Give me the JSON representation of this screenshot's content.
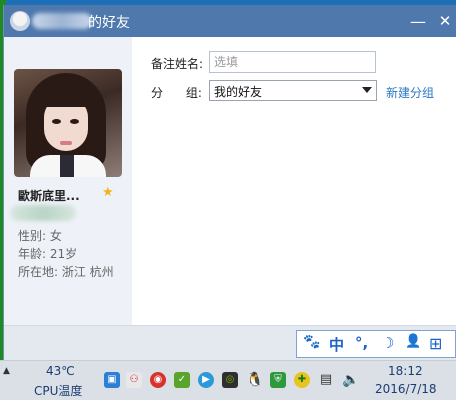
{
  "window": {
    "title": "的好友",
    "minimize_glyph": "—",
    "close_glyph": "✕"
  },
  "profile": {
    "name": "歐斯底里...",
    "gender": "性别: 女",
    "age": "年龄: 21岁",
    "location": "所在地: 浙江  杭州",
    "star_icon": "star-icon"
  },
  "form": {
    "remark_label": "备注姓名:",
    "remark_placeholder": "选填",
    "remark_value": "",
    "group_label": "分      组:",
    "group_value": "我的好友",
    "new_group_link": "新建分组"
  },
  "ime_bar": {
    "items": [
      "🐾",
      "中",
      "°,",
      "☽",
      "👤",
      "⊞"
    ]
  },
  "taskbar": {
    "temperature": "43℃",
    "cpu_label": "CPU温度",
    "time": "18:12",
    "date": "2016/7/18",
    "tray_colors": [
      "#2c7fd6",
      "#e0542c",
      "#d8322c",
      "#58a42c",
      "#2c9ad6",
      "#2f2f2f",
      "#1a1a1a",
      "#2c9a3c",
      "#3a9a2c",
      "#333333",
      "#444444"
    ]
  }
}
